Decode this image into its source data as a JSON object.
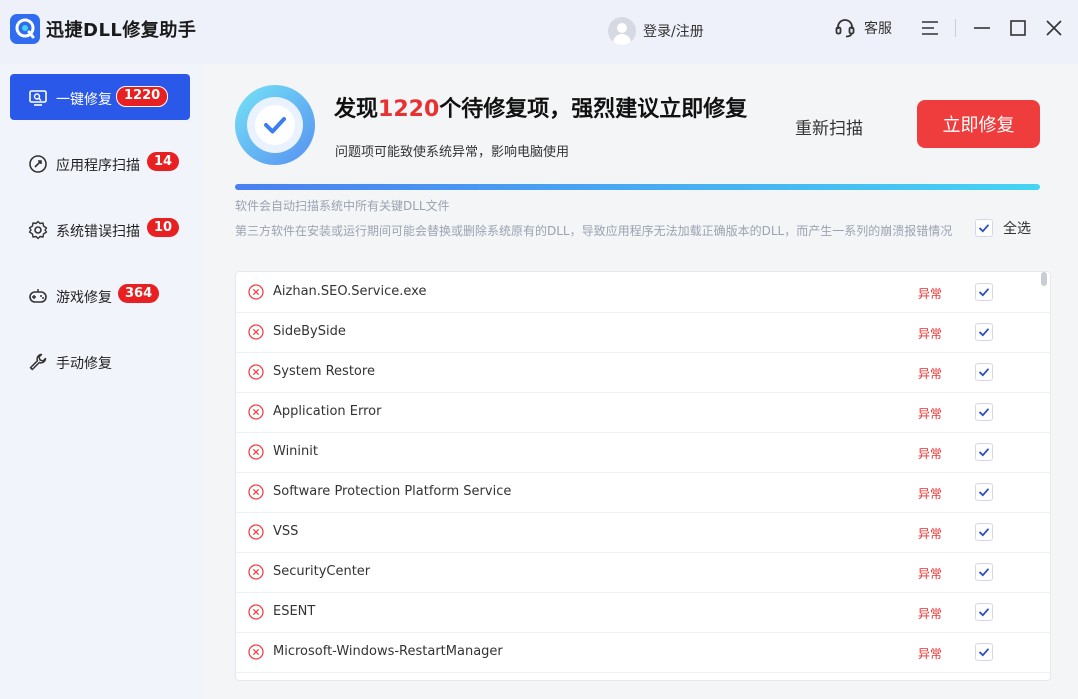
{
  "app": {
    "title": "迅捷DLL修复助手"
  },
  "titlebar": {
    "login": "登录/注册",
    "service": "客服"
  },
  "sidebar": {
    "items": [
      {
        "label": "一键修复",
        "badge": "1220",
        "icon": "monitor-icon",
        "active": true
      },
      {
        "label": "应用程序扫描",
        "badge": "14",
        "icon": "apps-icon",
        "active": false
      },
      {
        "label": "系统错误扫描",
        "badge": "10",
        "icon": "gear-icon",
        "active": false
      },
      {
        "label": "游戏修复",
        "badge": "364",
        "icon": "gamepad-icon",
        "active": false
      },
      {
        "label": "手动修复",
        "badge": "",
        "icon": "wrench-icon",
        "active": false
      }
    ]
  },
  "summary": {
    "prefix": "发现",
    "count": "1220",
    "suffix": "个待修复项，强烈建议立即修复",
    "subtitle": "问题项可能致使系统异常，影响电脑使用",
    "rescan": "重新扫描",
    "repair": "立即修复",
    "progress_percent": 100
  },
  "notes": {
    "line1": "软件会自动扫描系统中所有关键DLL文件",
    "line2": "第三方软件在安装或运行期间可能会替换或删除系统原有的DLL，导致应用程序无法加载正确版本的DLL，而产生一系列的崩溃报错情况"
  },
  "select_all": {
    "label": "全选",
    "checked": true
  },
  "list": {
    "items": [
      {
        "name": "Aizhan.SEO.Service.exe",
        "status": "异常",
        "checked": true
      },
      {
        "name": "SideBySide",
        "status": "异常",
        "checked": true
      },
      {
        "name": "System Restore",
        "status": "异常",
        "checked": true
      },
      {
        "name": "Application Error",
        "status": "异常",
        "checked": true
      },
      {
        "name": "Wininit",
        "status": "异常",
        "checked": true
      },
      {
        "name": "Software Protection Platform Service",
        "status": "异常",
        "checked": true
      },
      {
        "name": "VSS",
        "status": "异常",
        "checked": true
      },
      {
        "name": "SecurityCenter",
        "status": "异常",
        "checked": true
      },
      {
        "name": "ESENT",
        "status": "异常",
        "checked": true
      },
      {
        "name": "Microsoft-Windows-RestartManager",
        "status": "异常",
        "checked": true
      }
    ]
  },
  "colors": {
    "accent": "#2a58e8",
    "danger": "#e83232",
    "badge": "#e82021"
  }
}
